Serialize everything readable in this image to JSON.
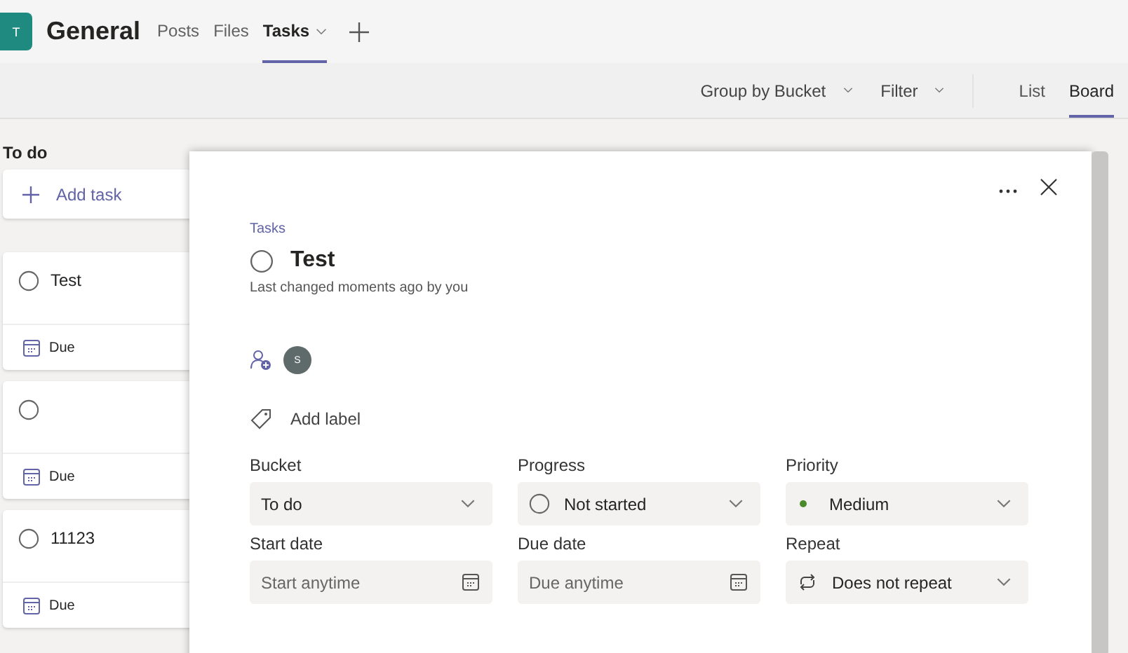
{
  "header": {
    "team_initial": "T",
    "channel": "General",
    "tabs": [
      {
        "label": "Posts",
        "selected": false,
        "dropdown": false
      },
      {
        "label": "Files",
        "selected": false,
        "dropdown": false
      },
      {
        "label": "Tasks",
        "selected": true,
        "dropdown": true
      }
    ]
  },
  "toolbar": {
    "menus": [
      {
        "label": "Group by Bucket"
      },
      {
        "label": "Filter"
      }
    ],
    "views": [
      {
        "label": "List",
        "selected": false
      },
      {
        "label": "Board",
        "selected": true
      }
    ]
  },
  "board": {
    "bucket": "To do",
    "add_task": "Add task",
    "tasks": [
      {
        "title": "Test",
        "completed": false,
        "due": "Due"
      },
      {
        "completed": false,
        "due": "Due"
      },
      {
        "title": "11123",
        "completed": false,
        "due": "Due"
      }
    ]
  },
  "task_panel": {
    "plan": "Tasks",
    "title": "Test",
    "completed": false,
    "last_changed": "Last changed moments ago by you",
    "assignee_initial": "S",
    "add_label": "Add label",
    "fields": [
      {
        "label": "Bucket",
        "kind": "select",
        "value": "To do"
      },
      {
        "label": "Progress",
        "kind": "progress",
        "value": "Not started"
      },
      {
        "label": "Priority",
        "kind": "priority",
        "value": "Medium",
        "color": "#4a8a2a"
      },
      {
        "label": "Start date",
        "kind": "date",
        "placeholder": "Start anytime"
      },
      {
        "label": "Due date",
        "kind": "date",
        "placeholder": "Due anytime"
      },
      {
        "label": "Repeat",
        "kind": "repeat",
        "value": "Does not repeat"
      }
    ]
  }
}
